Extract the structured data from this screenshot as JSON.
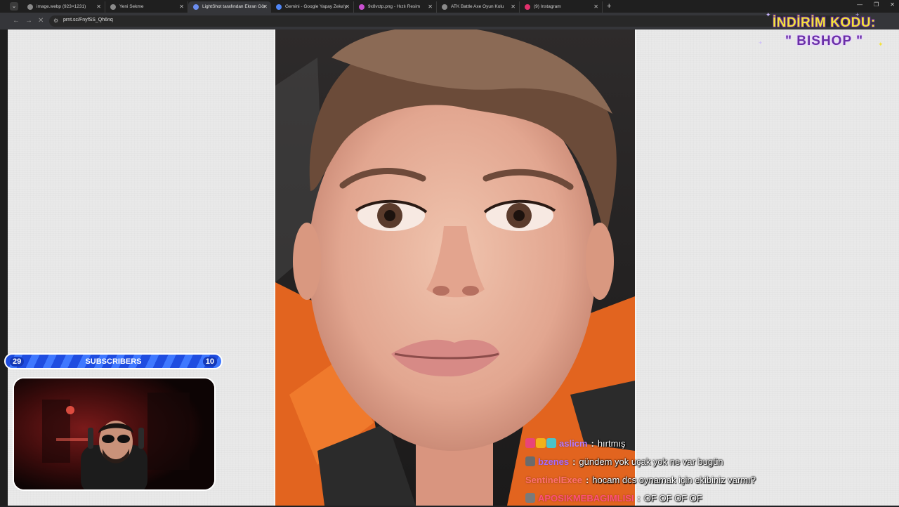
{
  "browser": {
    "tabs": [
      {
        "title": "image.webp (923×1231)",
        "favicon_color": "#8a8a8a",
        "active": false
      },
      {
        "title": "Yeni Sekme",
        "favicon_color": "#8a8a8a",
        "active": false
      },
      {
        "title": "LightShot tarafından Ekran Gör",
        "favicon_color": "#6b8df0",
        "active": true
      },
      {
        "title": "Gemini - Google Yapay Zeka'y",
        "favicon_color": "#4f86f7",
        "active": false
      },
      {
        "title": "9x8vctp.png - Hızlı Resim",
        "favicon_color": "#c94fd1",
        "active": false
      },
      {
        "title": "ATK Battle Axe Oyun Kolu",
        "favicon_color": "#8a8a8a",
        "active": false
      },
      {
        "title": "(9) Instagram",
        "favicon_color": "#e1306c",
        "active": false
      }
    ],
    "url": "prnt.sc/FnyfSS_Qh6nq",
    "new_tab_symbol": "+",
    "close_symbol": "✕"
  },
  "overlay": {
    "promo": {
      "line1": "İNDİRİM KODU:",
      "line2": "\" BISHOP \""
    },
    "subscribers": {
      "left_count": "29",
      "label": "SUBSCRIBERS",
      "right_count": "10"
    },
    "chat": [
      {
        "user": "aslicm",
        "user_color": "#b57bff",
        "text": "hırtmış",
        "badges": [
          "#e8457a",
          "#f2b21a",
          "#4cc3c9"
        ]
      },
      {
        "user": "bzenes",
        "user_color": "#a66bff",
        "text": "gündem yok uçak yok ne var bugün",
        "badges": [
          "#6b6b6b"
        ]
      },
      {
        "user": "SentinelExee",
        "user_color": "#ff6f6f",
        "text": "hocam dcs oynamak için ekibiniz varmı?",
        "badges": []
      },
      {
        "user": "APOSIKMEBAGIMLISI",
        "user_color": "#ff4f7a",
        "text": "OF OF OF OF",
        "badges": [
          "#7a7a7a"
        ]
      }
    ]
  },
  "colors": {
    "browser_bg": "#1f1f1f",
    "page_bg": "#e9e9e9",
    "subs_bar": "#2a5cf0",
    "promo_yellow": "#f4e23a",
    "promo_purple": "#6a2fa6"
  }
}
